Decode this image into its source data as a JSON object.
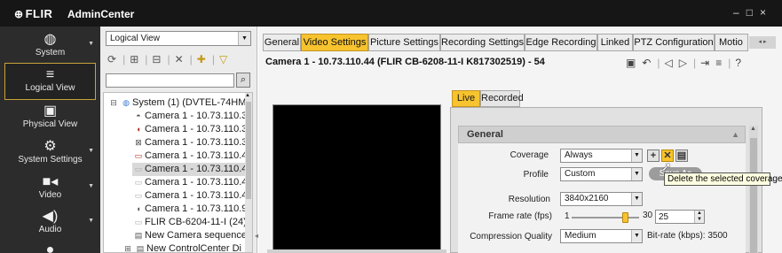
{
  "window": {
    "logo": "FLIR",
    "title": "AdminCenter",
    "controls": {
      "minimize": "–",
      "restore": "□",
      "close": "×"
    }
  },
  "nav": {
    "items": [
      {
        "label": "System",
        "icon": "globe-icon",
        "selected": false,
        "has_menu": true
      },
      {
        "label": "Logical View",
        "icon": "logical-view-icon",
        "selected": true,
        "has_menu": false
      },
      {
        "label": "Physical View",
        "icon": "physical-view-icon",
        "selected": false,
        "has_menu": false
      },
      {
        "label": "System Settings",
        "icon": "system-settings-icon",
        "selected": false,
        "has_menu": true
      },
      {
        "label": "Video",
        "icon": "video-camera-icon",
        "selected": false,
        "has_menu": true
      },
      {
        "label": "Audio",
        "icon": "speaker-icon",
        "selected": false,
        "has_menu": true
      }
    ]
  },
  "tree_panel": {
    "view_select": {
      "value": "Logical View"
    },
    "toolbar_icons": [
      "refresh-icon",
      "tree-expand-icon",
      "tree-collapse-icon",
      "delete-icon",
      "add-icon",
      "filter-icon"
    ],
    "search": {
      "value": "",
      "placeholder": ""
    },
    "tree": [
      {
        "label": "System (1) (DVTEL-74HMS",
        "icon": "system-globe-icon",
        "toggle": "⊟",
        "indent": 0,
        "highlighted": false
      },
      {
        "label": "Camera 1 - 10.73.110.3",
        "icon": "dome-camera-icon",
        "indent": 1,
        "highlighted": false
      },
      {
        "label": "Camera 1 - 10.73.110.3",
        "icon": "ptz-camera-icon",
        "indent": 1,
        "highlighted": false
      },
      {
        "label": "Camera 1 - 10.73.110.3",
        "icon": "multi-sensor-camera-icon",
        "indent": 1,
        "highlighted": false
      },
      {
        "label": "Camera 1 - 10.73.110.4",
        "icon": "bullet-camera-icon",
        "indent": 1,
        "highlighted": false
      },
      {
        "label": "Camera 1 - 10.73.110.4",
        "icon": "bullet-camera-offline-icon",
        "indent": 1,
        "highlighted": true
      },
      {
        "label": "Camera 1 - 10.73.110.4",
        "icon": "bullet-camera-offline-icon",
        "indent": 1,
        "highlighted": false
      },
      {
        "label": "Camera 1 - 10.73.110.4",
        "icon": "bullet-camera-offline-icon",
        "indent": 1,
        "highlighted": false
      },
      {
        "label": "Camera 1 - 10.73.110.9",
        "icon": "ptz-camera-icon",
        "indent": 1,
        "highlighted": false
      },
      {
        "label": "FLIR CB-6204-11-I (24)",
        "icon": "bullet-camera-offline-icon",
        "indent": 1,
        "highlighted": false
      },
      {
        "label": "New Camera sequence",
        "icon": "camera-sequence-icon",
        "indent": 1,
        "highlighted": false
      },
      {
        "label": "New ControlCenter Di",
        "icon": "controlcenter-icon",
        "toggle": "⊞",
        "indent": 1,
        "highlighted": false
      }
    ]
  },
  "main": {
    "tabs": [
      {
        "label": "General",
        "active": false
      },
      {
        "label": "Video Settings",
        "active": true
      },
      {
        "label": "Picture Settings",
        "active": false
      },
      {
        "label": "Recording Settings",
        "active": false
      },
      {
        "label": "Edge Recording",
        "active": false
      },
      {
        "label": "Linked",
        "active": false
      },
      {
        "label": "PTZ Configuration",
        "active": false
      },
      {
        "label": "Motio",
        "active": false
      }
    ],
    "camera_title": "Camera 1 - 10.73.110.44 (FLIR CB-6208-11-I K817302519) - 54",
    "camera_toolbar_icons": [
      "save-icon",
      "undo-icon",
      "previous-icon",
      "next-icon",
      "export-icon",
      "copy-to-icon",
      "help-icon"
    ],
    "video_tabs": [
      {
        "label": "Live",
        "active": true
      },
      {
        "label": "Recorded",
        "active": false
      }
    ],
    "settings": {
      "section_title": "General",
      "coverage": {
        "label": "Coverage",
        "value": "Always"
      },
      "profile": {
        "label": "Profile",
        "value": "Custom"
      },
      "profile_buttons": [
        "add-profile-icon",
        "delete-profile-icon",
        "profile-settings-icon"
      ],
      "save_as": {
        "label": "Save As"
      },
      "tooltip": "Delete the selected coverage",
      "resolution": {
        "label": "Resolution",
        "value": "3840x2160"
      },
      "frame_rate": {
        "label": "Frame rate (fps)",
        "min": "1",
        "max": "30",
        "value": "25",
        "level": 25
      },
      "compression": {
        "label": "Compression Quality",
        "value": "Medium"
      },
      "bitrate": {
        "label": "Bit-rate (kbps):",
        "value": "3500"
      }
    }
  }
}
